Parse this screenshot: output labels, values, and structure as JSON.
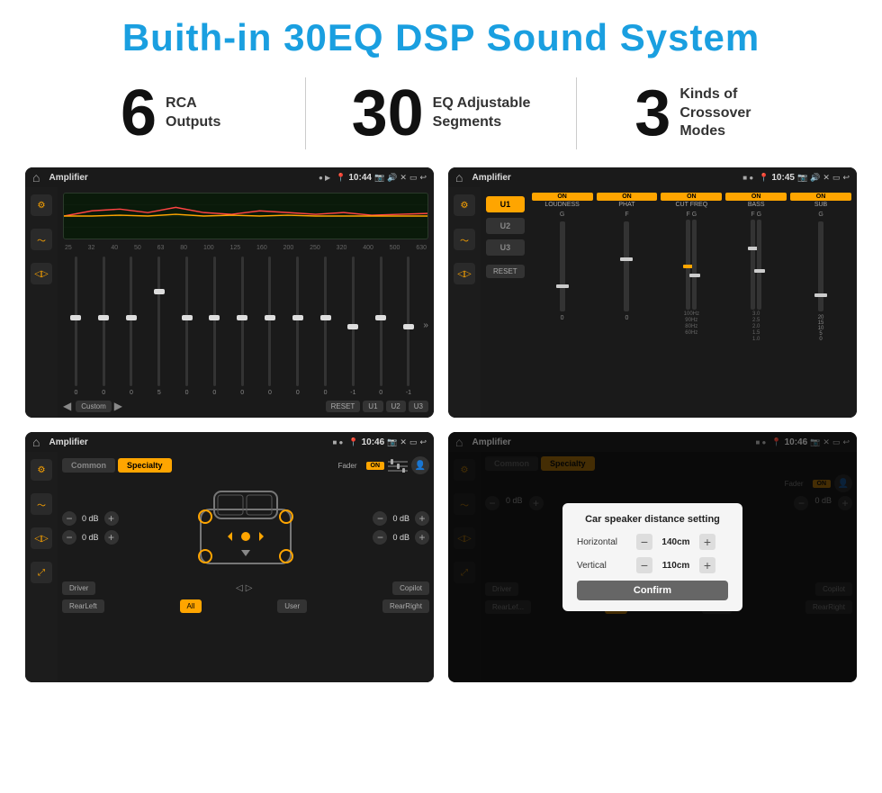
{
  "header": {
    "title": "Buith-in 30EQ DSP Sound System"
  },
  "stats": [
    {
      "number": "6",
      "label": "RCA\nOutputs"
    },
    {
      "number": "30",
      "label": "EQ Adjustable\nSegments"
    },
    {
      "number": "3",
      "label": "Kinds of\nCrossover Modes"
    }
  ],
  "screens": [
    {
      "id": "eq-screen",
      "statusBar": {
        "title": "Amplifier",
        "time": "10:44"
      }
    },
    {
      "id": "crossover-screen",
      "statusBar": {
        "title": "Amplifier",
        "time": "10:45"
      }
    },
    {
      "id": "fader-screen",
      "statusBar": {
        "title": "Amplifier",
        "time": "10:46"
      }
    },
    {
      "id": "dialog-screen",
      "statusBar": {
        "title": "Amplifier",
        "time": "10:46"
      },
      "dialog": {
        "title": "Car speaker distance setting",
        "horizontal_label": "Horizontal",
        "horizontal_value": "140cm",
        "vertical_label": "Vertical",
        "vertical_value": "110cm",
        "confirm_label": "Confirm"
      }
    }
  ],
  "eq": {
    "frequencies": [
      "25",
      "32",
      "40",
      "50",
      "63",
      "80",
      "100",
      "125",
      "160",
      "200",
      "250",
      "320",
      "400",
      "500",
      "630"
    ],
    "values": [
      "0",
      "0",
      "0",
      "5",
      "0",
      "0",
      "0",
      "0",
      "0",
      "0",
      "-1",
      "0",
      "-1"
    ],
    "presets": [
      "Custom",
      "RESET",
      "U1",
      "U2",
      "U3"
    ]
  },
  "crossover": {
    "presets": [
      "U1",
      "U2",
      "U3"
    ],
    "channels": [
      "LOUDNESS",
      "PHAT",
      "CUT FREQ",
      "BASS",
      "SUB"
    ],
    "reset_label": "RESET"
  },
  "fader": {
    "tabs": [
      "Common",
      "Specialty"
    ],
    "active_tab": "Specialty",
    "fader_label": "Fader",
    "on_label": "ON",
    "db_values": [
      "0 dB",
      "0 dB",
      "0 dB",
      "0 dB"
    ],
    "buttons": [
      "Driver",
      "Copilot",
      "RearLeft",
      "All",
      "User",
      "RearRight"
    ]
  },
  "dialog": {
    "title": "Car speaker distance setting",
    "horizontal_label": "Horizontal",
    "horizontal_value": "140cm",
    "vertical_label": "Vertical",
    "vertical_value": "110cm",
    "confirm_label": "Confirm"
  }
}
